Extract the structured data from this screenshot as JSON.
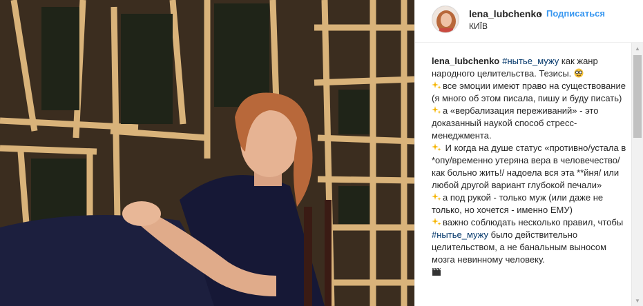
{
  "post": {
    "image_alt": "",
    "header": {
      "username": "lena_lubchenko",
      "separator": "•",
      "follow_label": "Подписаться",
      "location": "КИЇВ"
    },
    "caption": {
      "username": "lena_lubchenko",
      "lines": [
        {
          "before": "",
          "hashtag": "#нытье_мужу",
          "after": " как жанр народного целительства. Тезисы.",
          "emoji": "face"
        },
        {
          "icon": "sparkle",
          "before": "все эмоции имеют право на существование (я много об этом писала, пишу и буду писать)"
        },
        {
          "icon": "sparkle",
          "before": "а «вербализация переживаний» - это доказанный наукой способ стресс-менеджмента."
        },
        {
          "icon": "sparkle",
          "before": " И когда на душе статус «противно/устала в *опу/временно утеряна вера в человечество/как больно жить!/ надоела вся эта **йня/ или любой другой вариант глубокой печали»"
        },
        {
          "icon": "sparkle",
          "before": "а под рукой - только муж (или даже не только, но хочется - именно ЕМУ)"
        },
        {
          "icon": "sparkle",
          "before": "важно соблюдать несколько правил, чтобы ",
          "hashtag": "#нытье_мужу",
          "after": " было действительно целительством, а не банальным выносом мозга невинному человеку."
        },
        {
          "icon": "clapper",
          "before": ""
        }
      ]
    },
    "icons": {
      "sparkle": "sparkle-icon",
      "clapper": "clapper-board-icon",
      "face": "nerd-face-icon"
    },
    "colors": {
      "link_blue": "#3897f0",
      "hashtag": "#003569",
      "text": "#262626"
    }
  }
}
